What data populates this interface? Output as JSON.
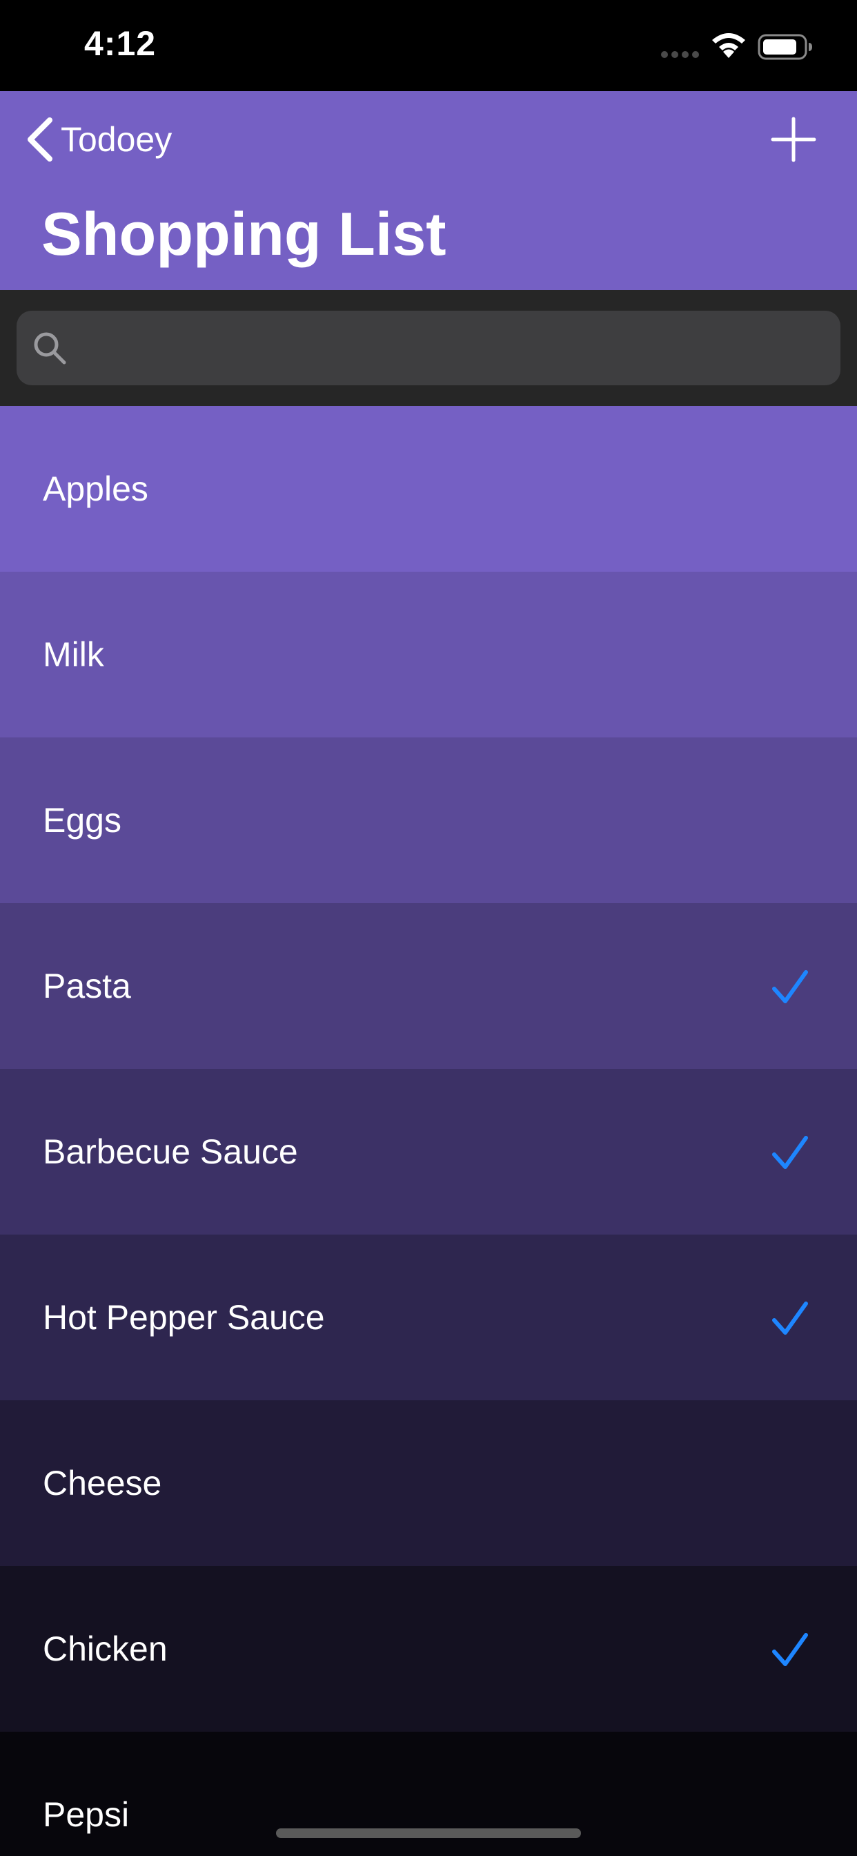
{
  "status_bar": {
    "time": "4:12"
  },
  "nav": {
    "back_label": "Todoey",
    "title": "Shopping List",
    "add_icon": "plus-icon",
    "back_icon": "chevron-left-icon"
  },
  "search": {
    "placeholder": "",
    "value": "",
    "icon": "search-icon"
  },
  "colors": {
    "accent": "#7560c4",
    "checkmark": "#1e86ff",
    "search_background": "#262626"
  },
  "items": [
    {
      "label": "Apples",
      "checked": false,
      "color": "#7560c4"
    },
    {
      "label": "Milk",
      "checked": false,
      "color": "#6855ae"
    },
    {
      "label": "Eggs",
      "checked": false,
      "color": "#5b4a98"
    },
    {
      "label": "Pasta",
      "checked": true,
      "color": "#4b3d7d"
    },
    {
      "label": "Barbecue Sauce",
      "checked": true,
      "color": "#3c3166"
    },
    {
      "label": "Hot Pepper Sauce",
      "checked": true,
      "color": "#2e264f"
    },
    {
      "label": "Cheese",
      "checked": false,
      "color": "#211b38"
    },
    {
      "label": "Chicken",
      "checked": true,
      "color": "#141121"
    },
    {
      "label": "Pepsi",
      "checked": false,
      "color": "#07060c"
    }
  ]
}
